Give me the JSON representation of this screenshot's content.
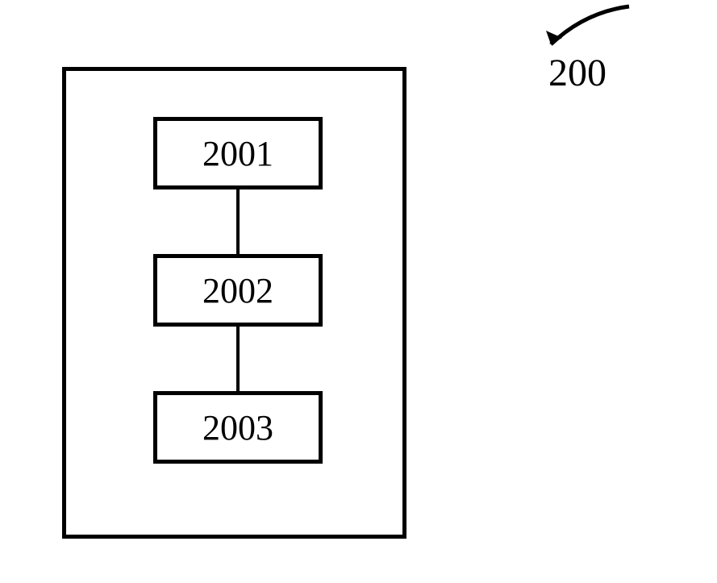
{
  "diagram": {
    "label": "200",
    "boxes": [
      {
        "text": "2001"
      },
      {
        "text": "2002"
      },
      {
        "text": "2003"
      }
    ]
  }
}
